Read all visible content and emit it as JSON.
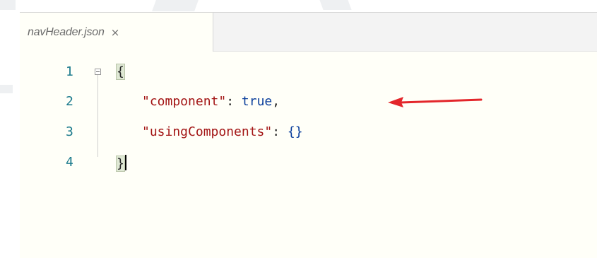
{
  "tab": {
    "title": "navHeader.json",
    "close_glyph": "×"
  },
  "editor": {
    "lines": [
      {
        "number": "1",
        "text": "{"
      },
      {
        "number": "2",
        "key": "\"component\"",
        "colon": ": ",
        "value": "true",
        "trail": ","
      },
      {
        "number": "3",
        "key": "\"usingComponents\"",
        "colon": ": ",
        "value": "{}"
      },
      {
        "number": "4",
        "text": "}"
      }
    ]
  },
  "annotation": {
    "arrow_color": "#e3262b",
    "icon": "red-arrow-icon"
  },
  "colors": {
    "string": "#a31515",
    "keyword": "#0b3f9c",
    "line_number": "#1b7a8c",
    "background": "#fffff8"
  }
}
